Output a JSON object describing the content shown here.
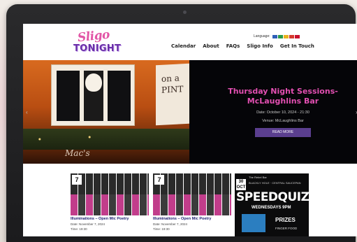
{
  "site": {
    "logo_top": "Sligo",
    "logo_bottom": "TONIGHT",
    "language_label": "Language:",
    "flags": [
      "#2f5fb8",
      "#2b9a48",
      "#e8b21e",
      "#d63a2f",
      "#c8102e"
    ]
  },
  "nav": {
    "items": [
      "Calendar",
      "About",
      "FAQs",
      "Sligo Info",
      "Get In Touch"
    ]
  },
  "hero": {
    "title": "Thursday Night Sessions-McLaughlins Bar",
    "date": "Date: October 10, 2024 - 21:30",
    "venue": "Venue: McLaughlins Bar",
    "button": "READ MORE",
    "sign_text": "on a PINT",
    "bottom_sign": "Mac's",
    "prev": "‹",
    "next": "›"
  },
  "cards": [
    {
      "number": "7",
      "title": "Illuminations – Open Mic Poetry",
      "date": "Date: November 7, 2024",
      "time": "Time: 19:30"
    },
    {
      "number": "7",
      "title": "Illuminations – Open Mic Poetry",
      "date": "Date: November 7, 2024",
      "time": "Time: 19:30"
    }
  ],
  "quiz": {
    "venue": "The Rebel Bar",
    "day": "30",
    "day_sub": "OCT",
    "sub": "BLACKLY HOLE · CENTRAL SAUCEPAN",
    "title": "SPEEDQUIZ",
    "when": "WEDNESDAYS 9PM",
    "prizes": "PRIZES",
    "food": "FINGER FOOD"
  },
  "colors": {
    "accent_pink": "#e24fb1",
    "accent_purple": "#5b3f8f",
    "hero_bg": "#050508"
  }
}
